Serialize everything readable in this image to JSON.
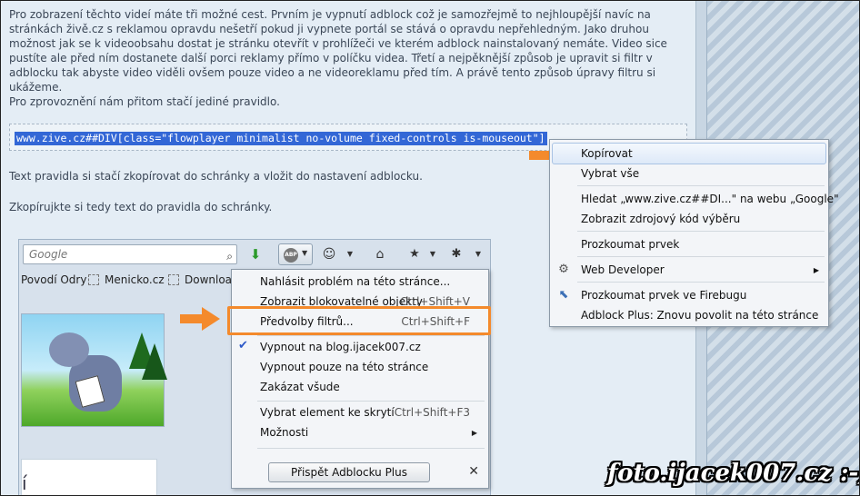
{
  "article": {
    "paragraph1": "Pro zobrazení těchto videí máte tři možné cest. Prvním je vypnutí adblock což je samozřejmě to nejhloupější navíc na stránkách živě.cz s reklamou opravdu nešetří pokud ji vypnete portál se stává o opravdu nepřehledným. Jako druhou možnost jak se k videoobsahu dostat je stránku otevřít v prohlížeči ve kterém adblock nainstalovaný nemáte. Video sice pustíte ale před ním dostanete další porci reklamy přímo v políčku videa. Třetí a nejpěknější způsob je upravit si filtr v adblocku tak abyste video viděli ovšem pouze video a ne videoreklamu před tím. A právě tento způsob úpravy filtru si ukážeme.",
    "paragraph2": "Pro zprovoznění nám přitom stačí jediné pravidlo.",
    "code": "www.zive.cz##DIV[class=\"flowplayer minimalist no-volume fixed-controls is-mouseout\"]",
    "paragraph3": "Text pravidla si stačí zkopírovat do schránky a vložit do nastavení adblocku.",
    "paragraph4": "Zkopírujkte si tedy text do pravidla do schránky."
  },
  "browser_toolbar": {
    "search_placeholder": "Google",
    "abp_badge": "ABP",
    "bookmarks": [
      "Povodí Odry",
      "Menicko.cz",
      "Downloa"
    ]
  },
  "cartoon_panel_text": "í",
  "abp_menu": {
    "items": [
      {
        "label": "Nahlásit problém na této stránce...",
        "shortcut": ""
      },
      {
        "label": "Zobrazit blokovatelné objekty",
        "shortcut": "Ctrl+Shift+V"
      },
      {
        "label": "Předvolby filtrů...",
        "shortcut": "Ctrl+Shift+F"
      },
      {
        "label": "Vypnout na blog.ijacek007.cz",
        "shortcut": ""
      },
      {
        "label": "Vypnout pouze na této stránce",
        "shortcut": ""
      },
      {
        "label": "Zakázat všude",
        "shortcut": ""
      },
      {
        "label": "Vybrat element ke skrytí",
        "shortcut": "Ctrl+Shift+F3"
      },
      {
        "label": "Možnosti",
        "shortcut": ""
      }
    ],
    "contribute_button": "Přispět Adblocku Plus",
    "close_glyph": "✕"
  },
  "context_menu": {
    "items": [
      "Kopírovat",
      "Vybrat vše",
      "Hledat „www.zive.cz##DI...\" na webu „Google\"",
      "Zobrazit zdrojový kód výběru",
      "Prozkoumat prvek",
      "Web Developer",
      "Prozkoumat prvek ve Firebugu",
      "Adblock Plus: Znovu povolit na této stránce"
    ]
  },
  "watermark": "foto.ijacek007.cz :-)",
  "colors": {
    "highlight": "#f48a2c",
    "selection": "#3367d6"
  }
}
